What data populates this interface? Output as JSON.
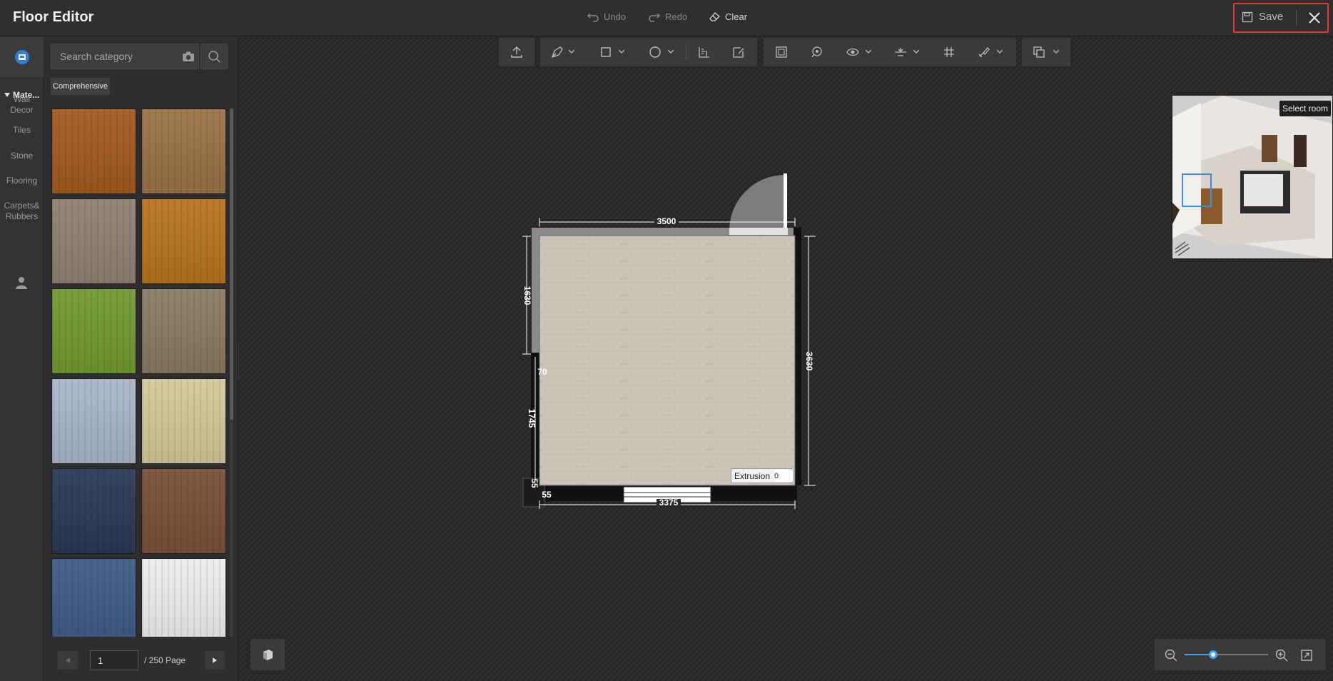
{
  "app": {
    "title": "Floor Editor"
  },
  "history": {
    "undo": "Undo",
    "redo": "Redo",
    "clear": "Clear"
  },
  "actions": {
    "save": "Save"
  },
  "rail": {
    "category": "Mate...",
    "items": [
      {
        "label": "Wall\nDecor"
      },
      {
        "label": "Tiles"
      },
      {
        "label": "Stone"
      },
      {
        "label": "Flooring"
      },
      {
        "label": "Carpets&\nRubbers"
      }
    ]
  },
  "panel": {
    "search_placeholder": "Search category",
    "chip": "Comprehensive",
    "page_current": "1",
    "page_total": "/ 250 Page",
    "tiles": [
      {
        "name": "cherry-wood",
        "color": "#a35a1e"
      },
      {
        "name": "oak-plank",
        "color": "#9b7248"
      },
      {
        "name": "grey-laminate",
        "color": "#8f8170"
      },
      {
        "name": "amber-wood",
        "color": "#b8741e"
      },
      {
        "name": "green-carpet",
        "color": "#6f9a2f"
      },
      {
        "name": "taupe-carpet",
        "color": "#8a7a62"
      },
      {
        "name": "blue-marble-wallpaper",
        "color": "#a9b6c8"
      },
      {
        "name": "damask-wallpaper",
        "color": "#d3c89a"
      },
      {
        "name": "navy-carpet",
        "color": "#2a3a55"
      },
      {
        "name": "walnut-wood",
        "color": "#7a5038"
      },
      {
        "name": "denim-carpet",
        "color": "#3f5c86"
      },
      {
        "name": "white-tile",
        "color": "#ececec"
      }
    ]
  },
  "canvas": {
    "dimensions": {
      "top": "3500",
      "bottom": "3375",
      "right": "3630",
      "left_upper": "1630",
      "left_lower": "1745",
      "notch": "70",
      "corner_a": "55",
      "corner_b": "55"
    },
    "extrusion_label": "Extrusion",
    "extrusion_value": "0",
    "select_room": "Select room"
  },
  "colors": {
    "accent": "#3ba5f5",
    "highlight": "#e53535",
    "floor": "#cbc2b8"
  }
}
